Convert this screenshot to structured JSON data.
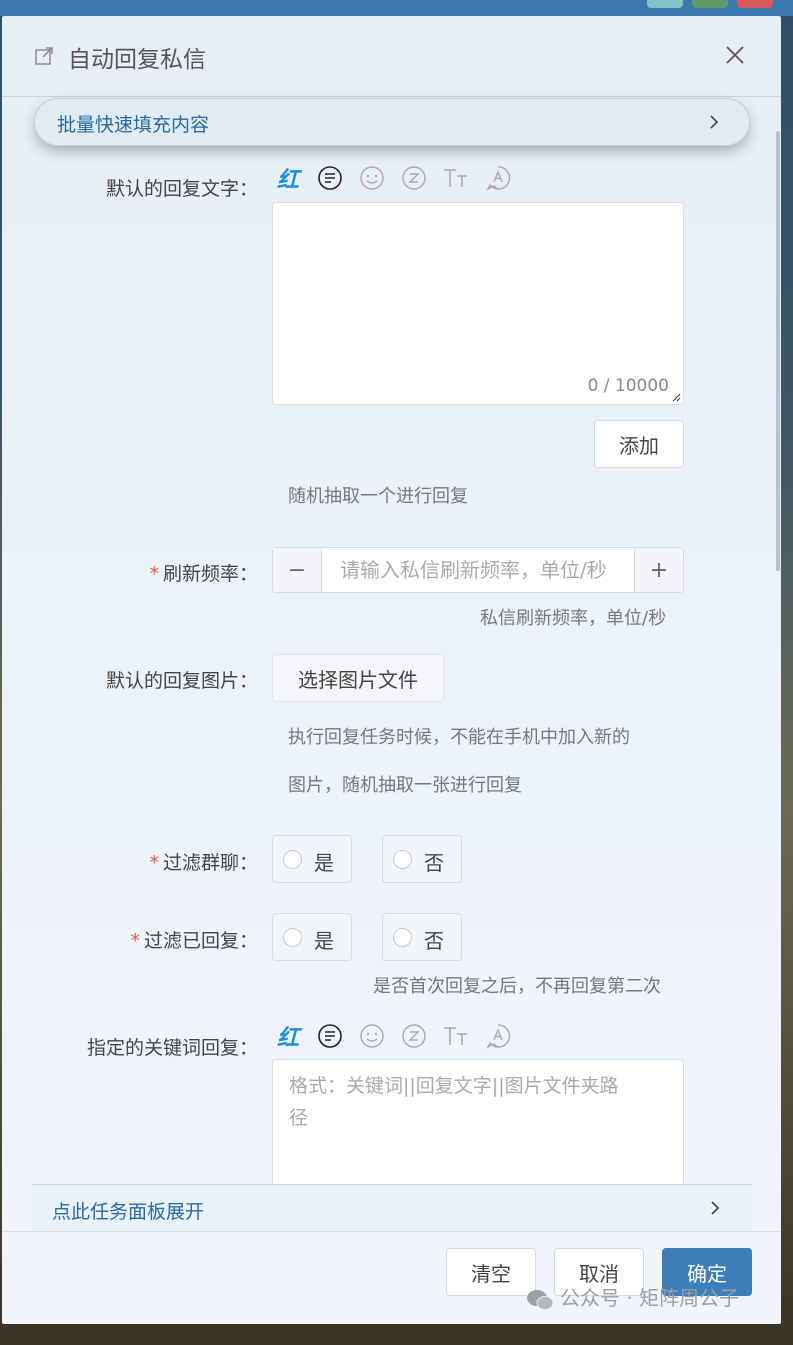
{
  "dialog": {
    "title": "自动回复私信",
    "batch_fill_label": "批量快速填充内容",
    "default_reply_text_label": "默认的回复文字：",
    "counter": "0 / 10000",
    "add_button": "添加",
    "random_hint": "随机抽取一个进行回复",
    "refresh_label": "刷新频率：",
    "refresh_placeholder": "请输入私信刷新频率，单位/秒",
    "refresh_hint": "私信刷新频率，单位/秒",
    "default_image_label": "默认的回复图片：",
    "select_image_button": "选择图片文件",
    "image_hint_line1": "执行回复任务时候，不能在手机中加入新的",
    "image_hint_line2": "图片，随机抽取一张进行回复",
    "filter_group_label": "过滤群聊：",
    "filter_replied_label": "过滤已回复：",
    "yes": "是",
    "no": "否",
    "filter_replied_hint": "是否首次回复之后，不再回复第二次",
    "keyword_label": "指定的关键词回复：",
    "keyword_placeholder_line1": "格式：关键词||回复文字||图片文件夹路",
    "keyword_placeholder_line2": "径",
    "expand_panel_label": "点此任务面板展开",
    "clear_button": "清空",
    "cancel_button": "取消",
    "confirm_button": "确定",
    "required_mark": "*",
    "toolbar_first_glyph": "红"
  },
  "watermark": "公众号 · 矩阵周公子",
  "colors": {
    "accent": "#3d7fba",
    "link": "#2a6aa3",
    "required": "#e5534b"
  },
  "icons": [
    "external-link-icon",
    "close-icon",
    "chevron-right-icon",
    "text-color-icon",
    "list-icon",
    "emoji-icon",
    "z-icon",
    "font-size-icon",
    "mention-icon",
    "wechat-icon"
  ]
}
